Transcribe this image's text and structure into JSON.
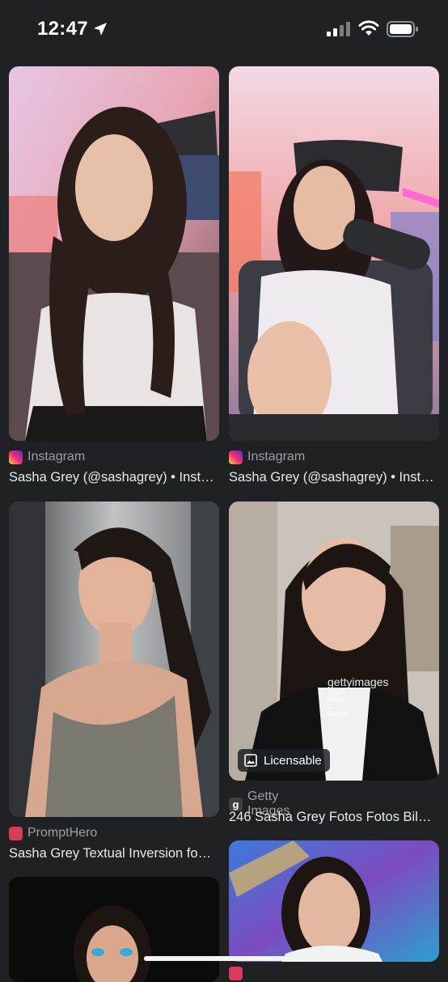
{
  "status_bar": {
    "time": "12:47"
  },
  "results": [
    {
      "source": "Instagram",
      "title": "Sasha Grey (@sashagrey) • Inst…",
      "source_icon": "instagram-icon"
    },
    {
      "source": "Instagram",
      "title": "Sasha Grey (@sashagrey) • Inst…",
      "source_icon": "instagram-icon"
    },
    {
      "source": "PromptHero",
      "title": "Sasha Grey Textual Inversion fo…",
      "source_icon": "prompthero-icon"
    },
    {
      "source": "Getty Images",
      "title": "246 Sasha Grey Fotos Fotos Bil…",
      "source_icon": "getty-icon",
      "badge": "Licensable",
      "watermark": "gettyimages",
      "watermark_credit": "Credit: Albert L. Ortega"
    }
  ],
  "colors": {
    "background": "#202124",
    "instagram": "#e1306c",
    "prompthero": "#d93b5a"
  }
}
